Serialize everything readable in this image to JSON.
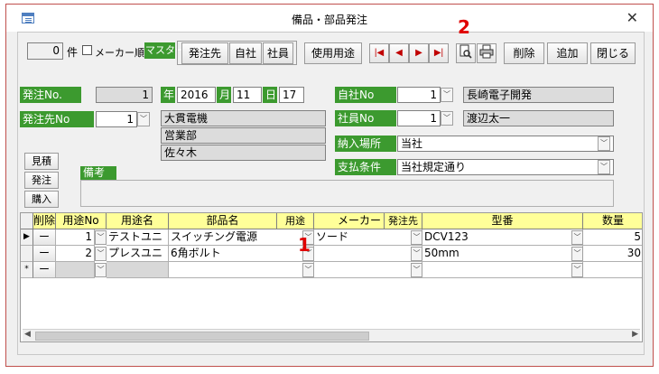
{
  "window": {
    "title": "備品・部品発注"
  },
  "toolbar": {
    "count_value": "0",
    "count_unit": "件",
    "maker_order_label": "メーカー順",
    "master_label": "マスター",
    "btn_supplier": "発注先",
    "btn_company": "自社",
    "btn_staff": "社員",
    "btn_usage": "使用用途",
    "btn_first": "|◀",
    "btn_prev": "◀",
    "btn_next": "▶",
    "btn_last": "▶|",
    "btn_delete": "削除",
    "btn_add": "追加",
    "btn_close": "閉じる"
  },
  "header": {
    "order_no_label": "発注No.",
    "order_no": "1",
    "year_label": "年",
    "year": "2016",
    "month_label": "月",
    "month": "11",
    "day_label": "日",
    "day": "17",
    "supplier_no_label": "発注先No",
    "supplier_no": "1",
    "supplier_name": "大貫電機",
    "supplier_dept": "営業部",
    "supplier_person": "佐々木",
    "company_no_label": "自社No",
    "company_no": "1",
    "company_name": "長崎電子開発",
    "staff_no_label": "社員No",
    "staff_no": "1",
    "staff_name": "渡辺太一",
    "delivery_label": "納入場所",
    "delivery_value": "当社",
    "payment_label": "支払条件",
    "payment_value": "当社規定通り",
    "note_label": "備考",
    "note_value": ""
  },
  "side_buttons": {
    "estimate": "見積",
    "order": "発注",
    "purchase": "購入"
  },
  "grid": {
    "headers": [
      "削除",
      "用途No",
      "用途名",
      "部品名",
      "用途",
      "メーカー",
      "発注先",
      "型番",
      "数量"
    ],
    "rows": [
      {
        "selector": "▶",
        "delete": "ー",
        "usage_no": "1",
        "usage_name": "テストユニ",
        "part_name": "スイッチング電源",
        "maker": "ソード",
        "model": "DCV123",
        "qty": "5"
      },
      {
        "selector": "",
        "delete": "ー",
        "usage_no": "2",
        "usage_name": "プレスユニ",
        "part_name": "6角ボルト",
        "maker": "",
        "model": "50mm",
        "qty": "30"
      },
      {
        "selector": "*",
        "delete": "ー",
        "usage_no": "",
        "usage_name": "",
        "part_name": "",
        "maker": "",
        "model": "",
        "qty": ""
      }
    ]
  },
  "annotations": {
    "one": "1",
    "two": "2"
  },
  "icons": {
    "preview": "print-preview-icon",
    "print": "printer-icon",
    "dropdown": "chevron-down-icon"
  }
}
